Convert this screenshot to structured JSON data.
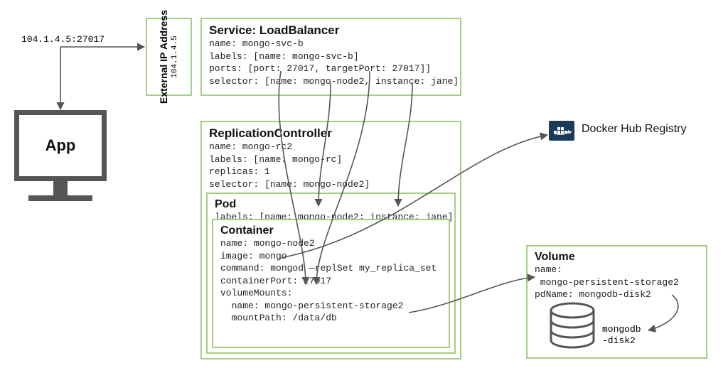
{
  "address": "104.1.4.5:27017",
  "app_label": "App",
  "external_ip": {
    "title": "External IP",
    "subtitle": "Address",
    "ip": "104.1.4.5"
  },
  "service": {
    "title": "Service: LoadBalancer",
    "body": "name: mongo-svc-b\nlabels: [name: mongo-svc-b]\nports: [port: 27017, targetPort: 27017]]\nselector: [name: mongo-node2, instance: jane]"
  },
  "rc": {
    "title": "ReplicationController",
    "body": "name: mongo-rc2\nlabels: [name: mongo-rc]\nreplicas: 1\nselector: [name: mongo-node2]"
  },
  "pod": {
    "title": "Pod",
    "body": "labels: [name: mongo-node2; instance: jane]"
  },
  "container": {
    "title": "Container",
    "body": "name: mongo-node2\nimage: mongo\ncommand: mongod —replSet my_replica_set\ncontainerPort: 27017\nvolumeMounts:\n  name: mongo-persistent-storage2\n  mountPath: /data/db"
  },
  "volume": {
    "title": "Volume",
    "body": "name:\n mongo-persistent-storage2\npdName: mongodb-disk2"
  },
  "docker": "Docker Hub Registry",
  "disk_label_1": "mongodb",
  "disk_label_2": "-disk2"
}
